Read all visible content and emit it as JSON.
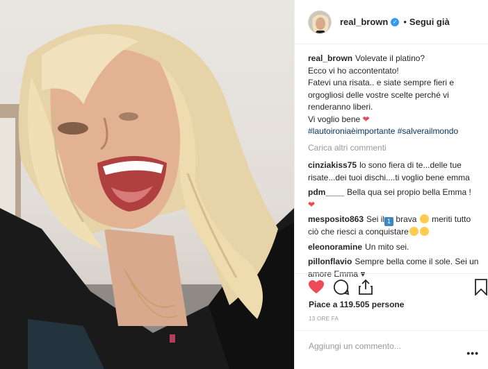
{
  "post": {
    "username": "real_brown",
    "follow_label": "Segui già",
    "caption": {
      "user": "real_brown",
      "lines": [
        "Volevate il platino?",
        "Ecco vi ho accontentato!",
        "Fatevi una risata.. e siate sempre fieri e",
        "orgogliosi delle vostre scelte perché vi",
        "renderanno liberi.",
        "Vi voglio bene"
      ],
      "hashtags": "#lautoironiaèimportante #salverailmondo"
    },
    "load_more_label": "Carica altri commenti",
    "comments": [
      {
        "user": "cinziakiss75",
        "text": "lo sono fiera di te...delle tue risate...dei tuoi dischi....ti voglio bene emma"
      },
      {
        "user": "pdm____",
        "text": "Bella qua sei propio bella Emma !"
      },
      {
        "user": "mesposito863",
        "text_a": "Sei il",
        "text_b": "brava",
        "text_c": "meriti tutto ciò che riesci a conquistare"
      },
      {
        "user": "eleonoramine",
        "text": "Un mito sei."
      },
      {
        "user": "pillonflavio",
        "text": "Sempre bella come il sole. Sei un amore Emma"
      }
    ],
    "likes_label": "Piace a 119.505 persone",
    "time_label": "13 ORE FA",
    "comment_placeholder": "Aggiungi un commento...",
    "more_options": "•••"
  },
  "icons": [
    "heart-icon",
    "comment-icon",
    "share-icon",
    "bookmark-icon",
    "verified-icon",
    "more-options-icon"
  ],
  "colors": {
    "like_heart": "#ed4956",
    "hashtag": "#003569",
    "verified": "#3897f0",
    "muted": "#999999"
  }
}
